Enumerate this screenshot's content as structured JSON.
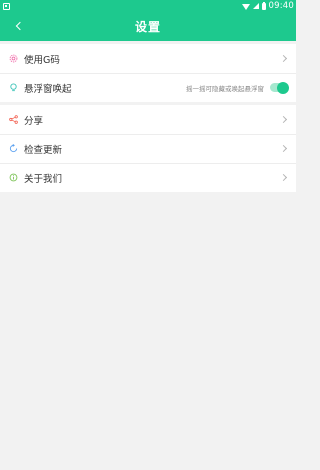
{
  "status_bar": {
    "time": "09:40"
  },
  "header": {
    "title": "设置"
  },
  "settings": {
    "use_code": {
      "label": "使用G码"
    },
    "floating_window": {
      "label": "悬浮窗唤起",
      "hint": "摇一摇可隐藏或唤起悬浮窗",
      "enabled": true
    },
    "share": {
      "label": "分享"
    },
    "check_update": {
      "label": "检查更新"
    },
    "about_us": {
      "label": "关于我们"
    }
  },
  "colors": {
    "accent": "#1dc98e",
    "background": "#f2f2f2",
    "icon_pink": "#f06aa8",
    "icon_teal": "#3cc4b8",
    "icon_red": "#f25a4a",
    "icon_blue": "#5aa0f0",
    "icon_green": "#7fc45a"
  },
  "icons": {
    "use_code": "circle-dashed-icon",
    "floating_window": "bulb-icon",
    "share": "share-icon",
    "check_update": "refresh-icon",
    "about_us": "info-icon"
  }
}
